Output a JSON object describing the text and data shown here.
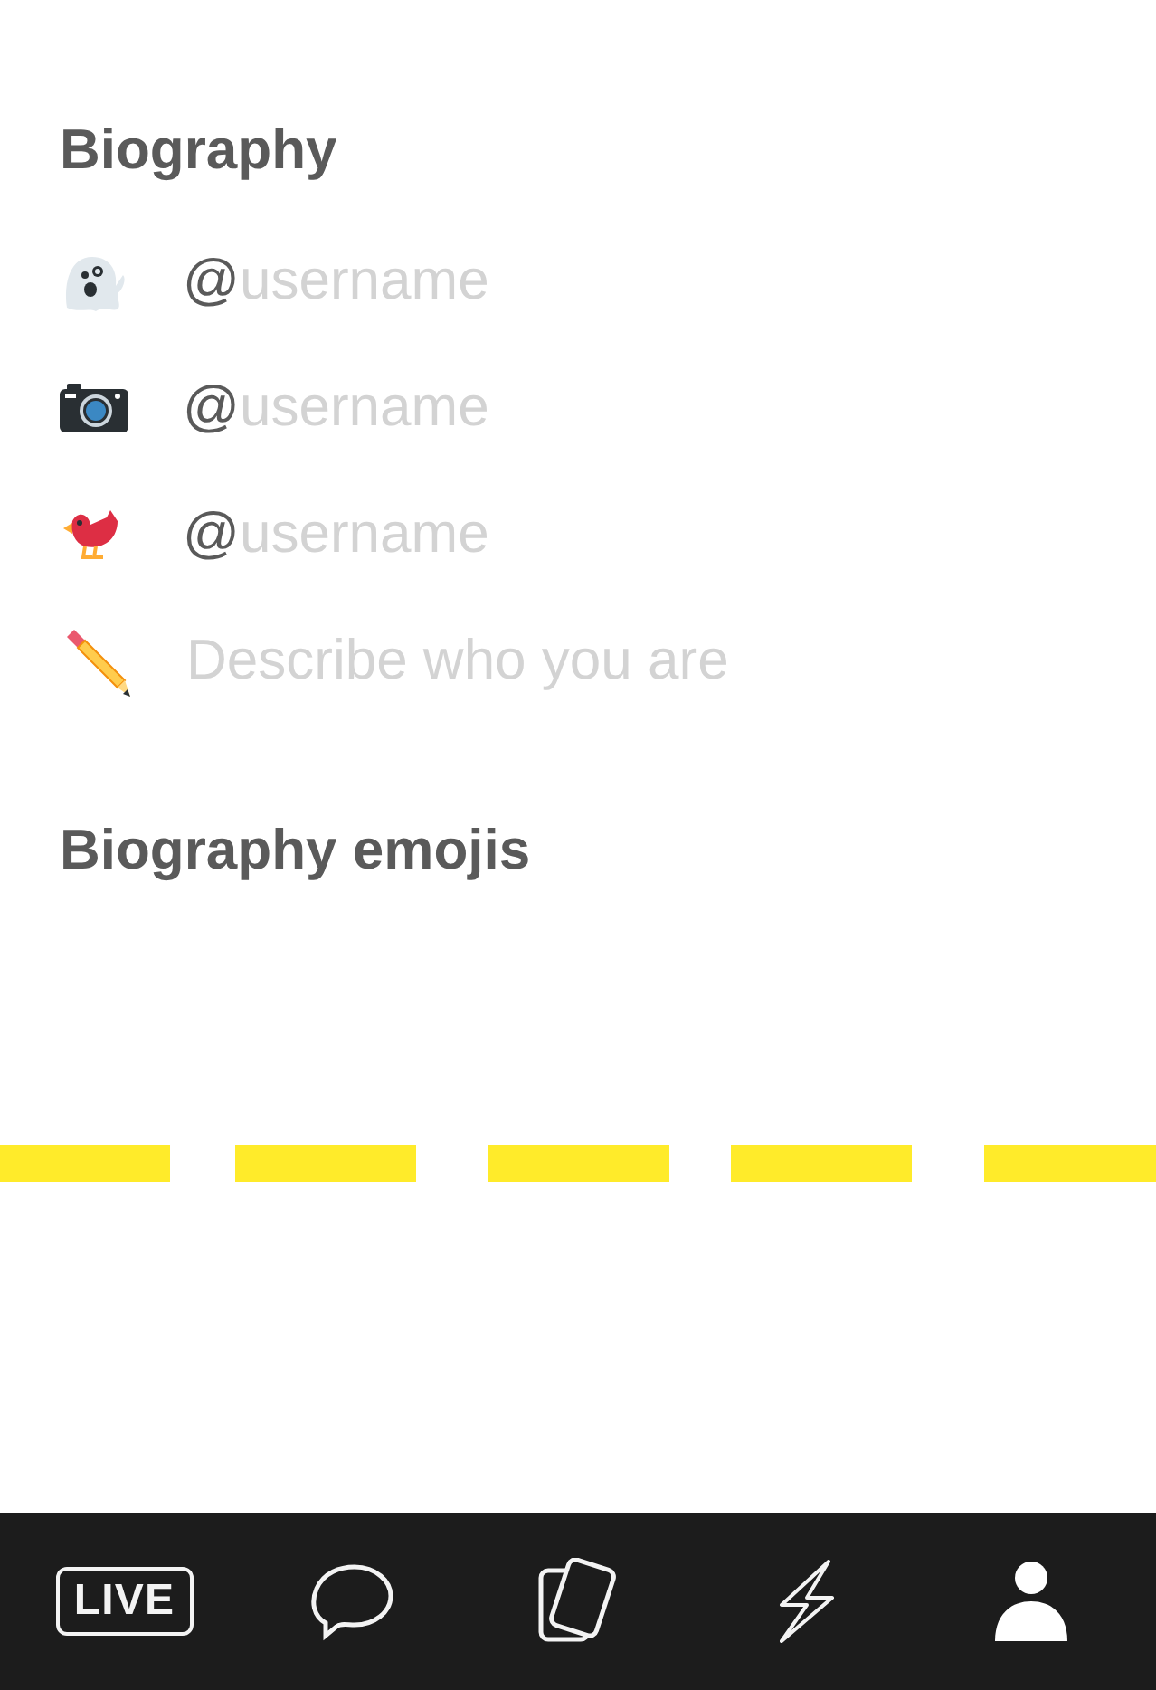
{
  "biography": {
    "title": "Biography",
    "fields": [
      {
        "kind": "ghost",
        "prefix": "@",
        "placeholder": "username"
      },
      {
        "kind": "camera",
        "prefix": "@",
        "placeholder": "username"
      },
      {
        "kind": "bird",
        "prefix": "@",
        "placeholder": "username"
      },
      {
        "kind": "pencil",
        "placeholder": "Describe who you are"
      }
    ]
  },
  "emojis_section": {
    "title": "Biography emojis"
  },
  "tab_bar": [
    {
      "kind": "live",
      "label": "LIVE",
      "selected": false
    },
    {
      "kind": "chat",
      "selected": false
    },
    {
      "kind": "cards",
      "selected": false
    },
    {
      "kind": "bolt",
      "selected": false
    },
    {
      "kind": "person",
      "selected": true
    }
  ]
}
